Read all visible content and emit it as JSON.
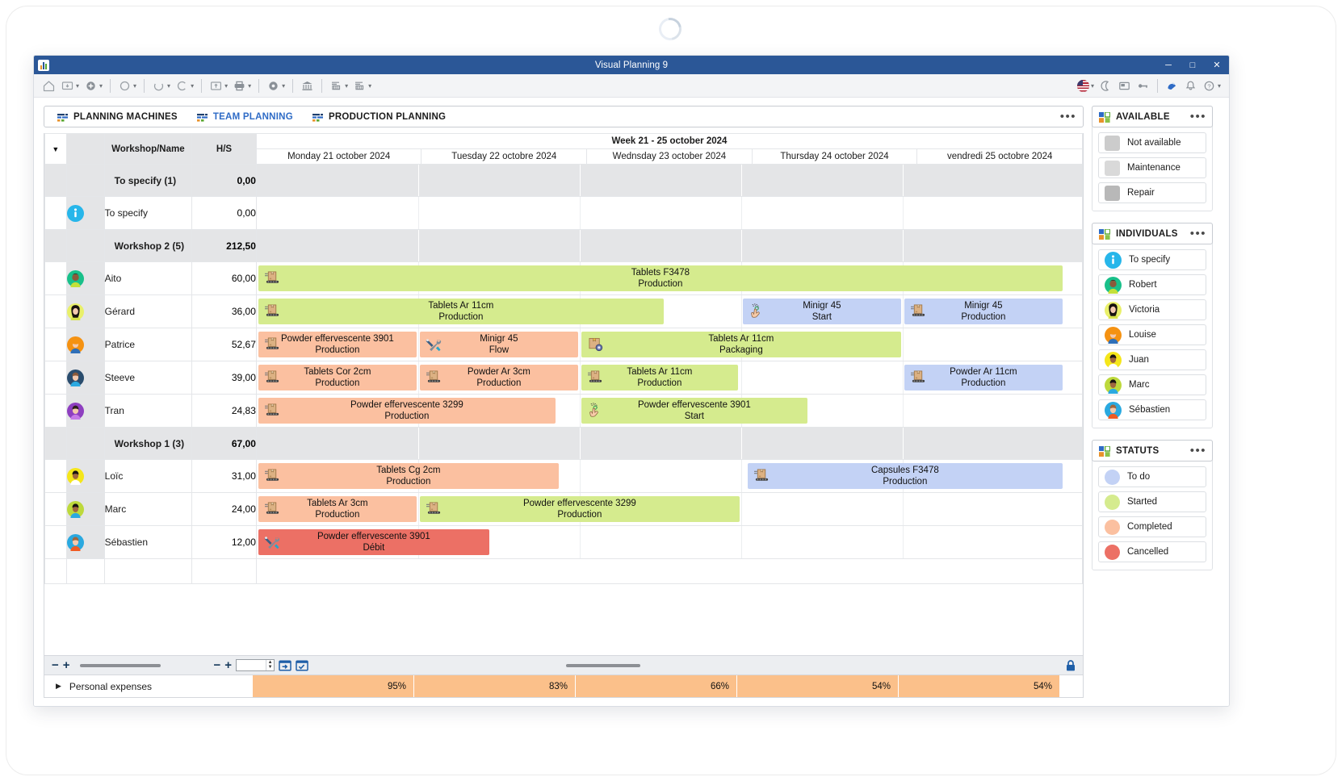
{
  "window": {
    "title": "Visual Planning 9",
    "minimize": "─",
    "maximize": "□",
    "close": "✕"
  },
  "toolbar": {
    "items": [
      {
        "name": "home-icon",
        "has_caret": false
      },
      {
        "name": "board-icon",
        "has_caret": true
      },
      {
        "name": "add-circle-icon",
        "has_caret": true
      },
      {
        "name": "refresh-circle-icon",
        "has_caret": true
      },
      {
        "name": "undo-icon",
        "has_caret": true
      },
      {
        "name": "redo-icon",
        "has_caret": true
      },
      {
        "name": "export-image-icon",
        "has_caret": true
      },
      {
        "name": "print-icon",
        "has_caret": true
      },
      {
        "name": "record-icon",
        "has_caret": true
      },
      {
        "name": "bank-icon",
        "has_caret": false
      },
      {
        "name": "filter-in-icon",
        "has_caret": true
      },
      {
        "name": "filter-out-icon",
        "has_caret": true
      }
    ],
    "right_items": [
      {
        "name": "language-flag-icon",
        "has_caret": true
      },
      {
        "name": "dark-mode-moon-icon",
        "has_caret": false
      },
      {
        "name": "window-layout-icon",
        "has_caret": false
      },
      {
        "name": "key-icon",
        "has_caret": false
      },
      {
        "name": "support-icon",
        "has_caret": false
      },
      {
        "name": "notifications-bell-icon",
        "has_caret": false
      },
      {
        "name": "help-icon",
        "has_caret": true
      }
    ]
  },
  "tabs": [
    {
      "label": "PLANNING MACHINES",
      "active": false
    },
    {
      "label": "TEAM PLANNING",
      "active": true
    },
    {
      "label": "PRODUCTION PLANNING",
      "active": false
    }
  ],
  "tabs_overflow": "•••",
  "grid": {
    "columns": {
      "name": "Workshop/Name",
      "hs": "H/S"
    },
    "week_label": "Week 21 - 25 october 2024",
    "days": [
      "Monday 21 october 2024",
      "Tuesday 22 octobre 2024",
      "Wednsday 23 october 2024",
      "Thursday 24 october 2024",
      "vendredi 25 octobre 2024"
    ],
    "rows": [
      {
        "type": "group",
        "name": "To specify (1)",
        "hs": "0,00",
        "avatar": null,
        "hs_color": "none"
      },
      {
        "type": "resource",
        "name": "To specify",
        "hs": "0,00",
        "avatar": "info",
        "hs_color": "none"
      },
      {
        "type": "group",
        "name": "Workshop 2 (5)",
        "hs": "212,50",
        "avatar": null,
        "hs_color": "none"
      },
      {
        "type": "resource",
        "name": "Aito",
        "hs": "60,00",
        "avatar": "aito",
        "hs_color": "red"
      },
      {
        "type": "resource",
        "name": "Gérard",
        "hs": "36,00",
        "avatar": "gerard",
        "hs_color": "red"
      },
      {
        "type": "resource",
        "name": "Patrice",
        "hs": "52,67",
        "avatar": "patrice",
        "hs_color": "red"
      },
      {
        "type": "resource",
        "name": "Steeve",
        "hs": "39,00",
        "avatar": "steeve",
        "hs_color": "red"
      },
      {
        "type": "resource",
        "name": "Tran",
        "hs": "24,83",
        "avatar": "tran",
        "hs_color": "green"
      },
      {
        "type": "group",
        "name": "Workshop 1 (3)",
        "hs": "67,00",
        "avatar": null,
        "hs_color": "none"
      },
      {
        "type": "resource",
        "name": "Loïc",
        "hs": "31,00",
        "avatar": "loic",
        "hs_color": "green"
      },
      {
        "type": "resource",
        "name": "Marc",
        "hs": "24,00",
        "avatar": "marc",
        "hs_color": "green"
      },
      {
        "type": "resource",
        "name": "Sébastien",
        "hs": "12,00",
        "avatar": "sebastien",
        "hs_color": "green"
      }
    ],
    "tasks": {
      "Aito": [
        {
          "title": "Tablets F3478",
          "subtitle": "Production",
          "color": "green",
          "icon": "conveyor-box-icon",
          "start": 0,
          "span": 5
        }
      ],
      "Gérard": [
        {
          "title": "Tablets Ar 11cm",
          "subtitle": "Production",
          "color": "green",
          "icon": "conveyor-box-icon",
          "start": 0,
          "span": 2.53
        },
        {
          "title": "Minigr 45",
          "subtitle": "Start",
          "color": "blue",
          "icon": "hand-touch-icon",
          "start": 3,
          "span": 1
        },
        {
          "title": "Minigr 45",
          "subtitle": "Production",
          "color": "blue",
          "icon": "conveyor-box-icon",
          "start": 4,
          "span": 1
        }
      ],
      "Patrice": [
        {
          "title": "Powder effervescente 3901",
          "subtitle": "Production",
          "color": "orange",
          "icon": "conveyor-box-icon",
          "start": 0,
          "span": 1
        },
        {
          "title": "Minigr 45",
          "subtitle": "Flow",
          "color": "orange",
          "icon": "tools-icon",
          "start": 1,
          "span": 1
        },
        {
          "title": "Tablets  Ar 11cm",
          "subtitle": "Packaging",
          "color": "green",
          "icon": "package-target-icon",
          "start": 2,
          "span": 2
        }
      ],
      "Steeve": [
        {
          "title": "Tablets  Cor 2cm",
          "subtitle": "Production",
          "color": "orange",
          "icon": "conveyor-box-icon",
          "start": 0,
          "span": 1
        },
        {
          "title": "Powder Ar 3cm",
          "subtitle": "Production",
          "color": "orange",
          "icon": "conveyor-box-icon",
          "start": 1,
          "span": 1
        },
        {
          "title": "Tablets  Ar 11cm",
          "subtitle": "Production",
          "color": "green",
          "icon": "conveyor-box-icon",
          "start": 2,
          "span": 0.99
        },
        {
          "title": "Powder Ar 11cm",
          "subtitle": "Production",
          "color": "blue",
          "icon": "conveyor-box-icon",
          "start": 4,
          "span": 1
        }
      ],
      "Tran": [
        {
          "title": "Powder effervescente 3299",
          "subtitle": "Production",
          "color": "orange",
          "icon": "conveyor-box-icon",
          "start": 0,
          "span": 1.86
        },
        {
          "title": "Powder effervescente 3901",
          "subtitle": "Start",
          "color": "green",
          "icon": "hand-touch-icon",
          "start": 2,
          "span": 1.42
        }
      ],
      "Loïc": [
        {
          "title": "Tablets Cg 2cm",
          "subtitle": "Production",
          "color": "orange",
          "icon": "conveyor-box-icon",
          "start": 0,
          "span": 1.88
        },
        {
          "title": "Capsules F3478",
          "subtitle": "Production",
          "color": "blue",
          "icon": "conveyor-box-icon",
          "start": 3.03,
          "span": 1.97
        }
      ],
      "Marc": [
        {
          "title": "Tablets Ar 3cm",
          "subtitle": "Production",
          "color": "orange",
          "icon": "conveyor-box-icon",
          "start": 0,
          "span": 1
        },
        {
          "title": "Powder effervescente 3299",
          "subtitle": "Production",
          "color": "green",
          "icon": "conveyor-box-icon",
          "start": 1,
          "span": 2
        }
      ],
      "Sébastien": [
        {
          "title": "Powder effervescente 3901",
          "subtitle": "Débit",
          "color": "red",
          "icon": "tools-icon",
          "start": 0,
          "span": 1.45
        }
      ]
    }
  },
  "footer": {
    "zoom_minus": "−",
    "zoom_plus": "+",
    "time_minus": "−",
    "time_plus": "+",
    "spin_value": "",
    "today-calendar-icon": "today-calendar-icon",
    "check-calendar-icon": "check-calendar-icon",
    "lock-icon": "lock-icon"
  },
  "expenses": {
    "label": "Personal expenses",
    "expander": "▶",
    "values": [
      "95%",
      "83%",
      "66%",
      "54%",
      "54%"
    ]
  },
  "panels": {
    "available": {
      "title": "AVAILABLE",
      "dots": "•••",
      "items": [
        {
          "label": "Not available",
          "swatch": "#cccccc"
        },
        {
          "label": "Maintenance",
          "swatch": "#d9d9d9"
        },
        {
          "label": "Repair",
          "swatch": "#b8b8b8"
        }
      ]
    },
    "individuals": {
      "title": "INDIVIDUALS",
      "dots": "•••",
      "items": [
        {
          "label": "To specify",
          "avatar": "info"
        },
        {
          "label": "Robert",
          "avatar": "aito"
        },
        {
          "label": "Victoria",
          "avatar": "gerard"
        },
        {
          "label": "Louise",
          "avatar": "patrice"
        },
        {
          "label": "Juan",
          "avatar": "loic"
        },
        {
          "label": "Marc",
          "avatar": "marc"
        },
        {
          "label": "Sébastien",
          "avatar": "sebastien"
        }
      ]
    },
    "statuts": {
      "title": "STATUTS",
      "dots": "•••",
      "items": [
        {
          "label": "To do",
          "color": "#c3d2f5"
        },
        {
          "label": "Started",
          "color": "#d5eb8e"
        },
        {
          "label": "Completed",
          "color": "#fbc0a0"
        },
        {
          "label": "Cancelled",
          "color": "#ec7065"
        }
      ]
    }
  }
}
